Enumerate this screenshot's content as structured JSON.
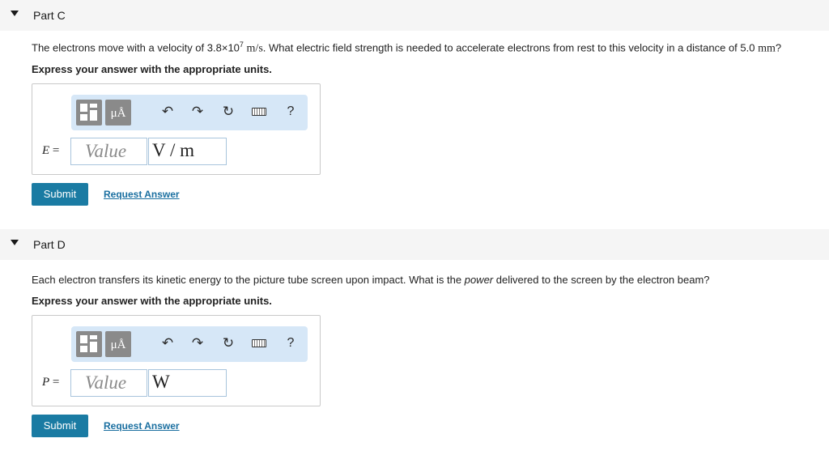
{
  "parts": [
    {
      "title": "Part C",
      "question": {
        "pre": "The electrons move with a velocity of 3.8",
        "times": "×",
        "base": "10",
        "exp": "7",
        "unit_math": "m/s",
        "mid": ". What electric field strength is needed to accelerate electrons from rest to this velocity in a distance of 5.0",
        "dist_unit": "mm",
        "end": "?"
      },
      "instruction": "Express your answer with the appropriate units.",
      "toolbar": {
        "units_label": "μÅ",
        "help_label": "?"
      },
      "variable": "E",
      "equals": "=",
      "value_placeholder": "Value",
      "unit_value": "V / m",
      "submit_label": "Submit",
      "request_label": "Request Answer"
    },
    {
      "title": "Part D",
      "question": {
        "pre": "Each electron transfers its kinetic energy to the picture tube screen upon impact. What is the ",
        "em": "power",
        "post": " delivered to the screen by the electron beam?"
      },
      "instruction": "Express your answer with the appropriate units.",
      "toolbar": {
        "units_label": "μÅ",
        "help_label": "?"
      },
      "variable": "P",
      "equals": "=",
      "value_placeholder": "Value",
      "unit_value": "W",
      "submit_label": "Submit",
      "request_label": "Request Answer"
    }
  ],
  "icons": {
    "caret": "caret-down-icon",
    "template": "template-icon",
    "undo": "undo-icon",
    "redo": "redo-icon",
    "reset": "reset-icon",
    "keyboard": "keyboard-icon",
    "help": "help-icon"
  },
  "colors": {
    "header_bg": "#f5f5f5",
    "toolbar_bg": "#d6e7f7",
    "submit_bg": "#1a7ba3",
    "link": "#1a6fa0"
  }
}
